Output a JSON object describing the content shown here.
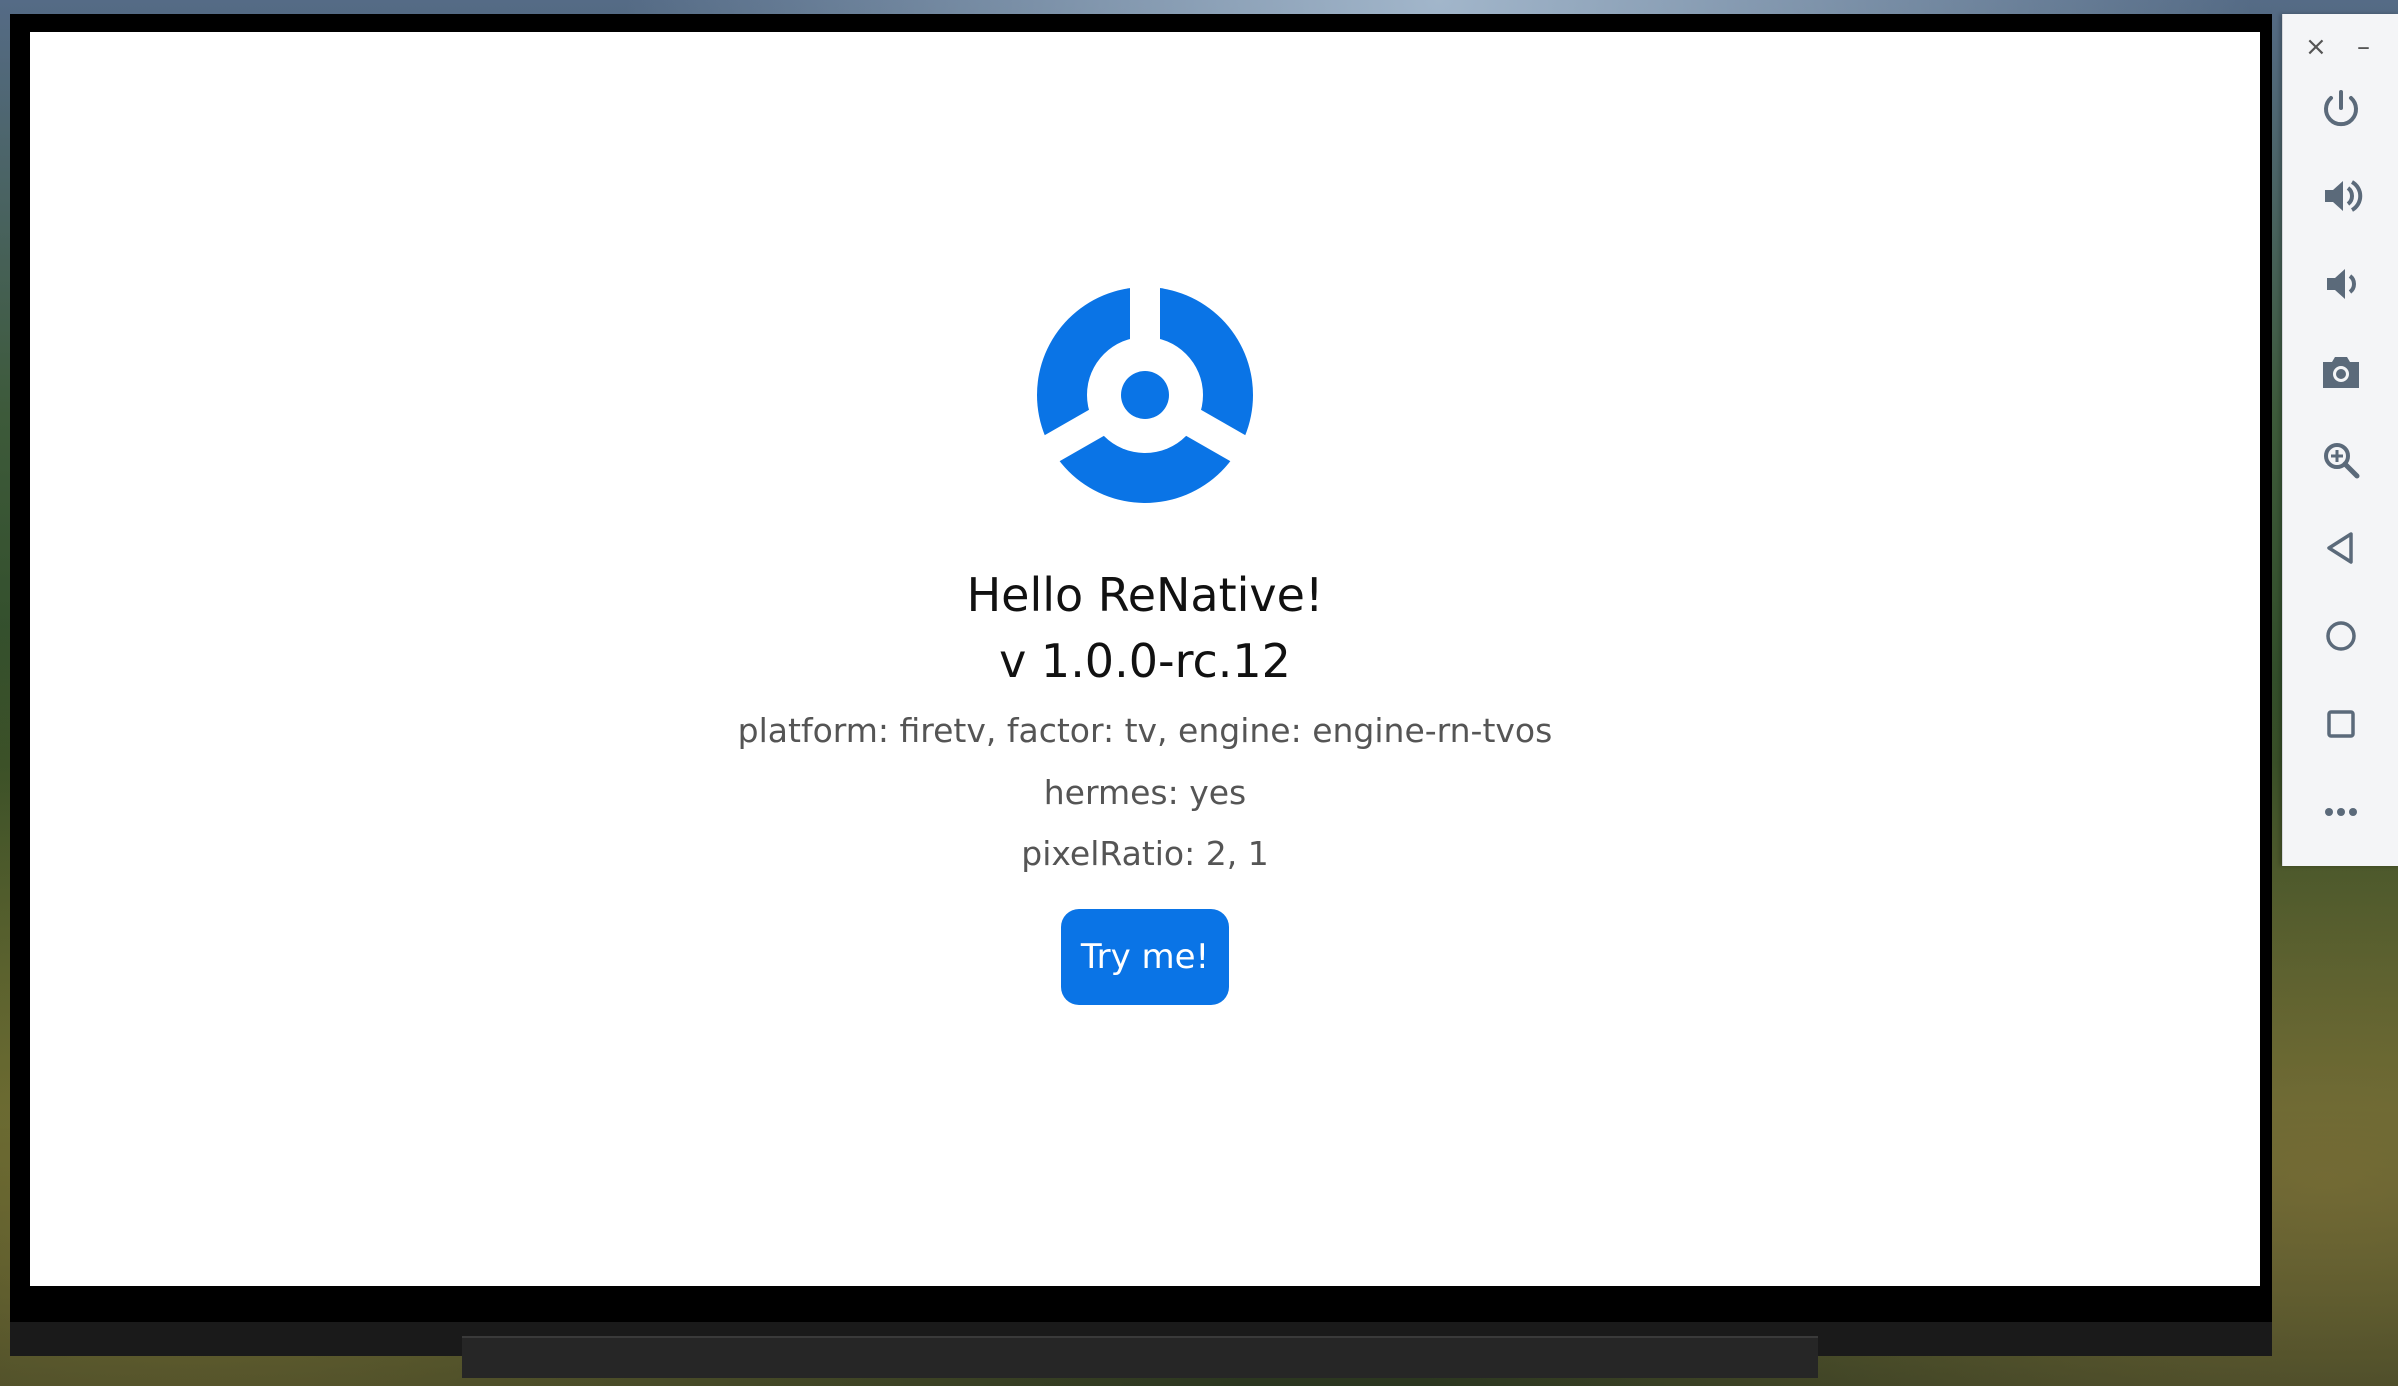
{
  "app": {
    "title": "Hello ReNative!",
    "version": "v 1.0.0-rc.12",
    "platform_line": "platform: firetv, factor: tv, engine: engine-rn-tvos",
    "hermes_line": "hermes: yes",
    "pixel_line": "pixelRatio: 2, 1",
    "button_label": "Try me!",
    "logo": "renative-logo",
    "accent_color": "#0a74e6"
  },
  "emulator_toolbar": {
    "close_label": "×",
    "minimize_label": "–",
    "buttons": [
      {
        "name": "power-icon"
      },
      {
        "name": "volume-up-icon"
      },
      {
        "name": "volume-down-icon"
      },
      {
        "name": "camera-icon"
      },
      {
        "name": "zoom-icon"
      },
      {
        "name": "back-icon"
      },
      {
        "name": "home-icon"
      },
      {
        "name": "overview-icon"
      },
      {
        "name": "more-icon"
      }
    ]
  }
}
